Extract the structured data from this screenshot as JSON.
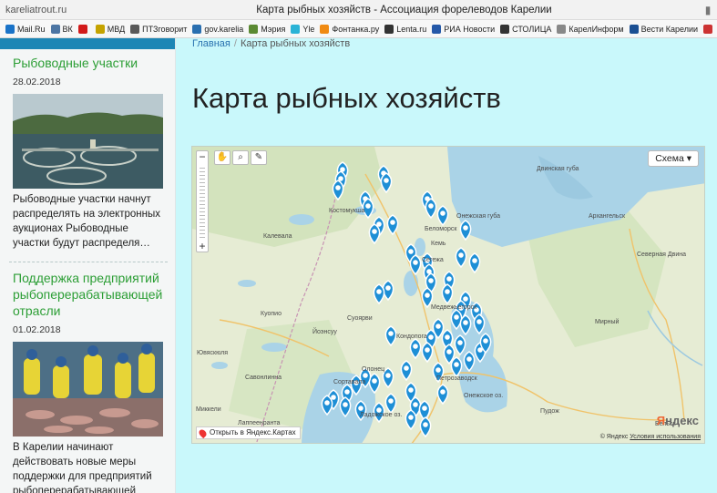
{
  "window": {
    "host": "kareliatrout.ru",
    "title": "Карта рыбных хозяйств - Ассоциация форелеводов Карелии",
    "bookmark_star": "▮"
  },
  "bookmarks": [
    {
      "label": "Mail.Ru",
      "color": "#1a73c8"
    },
    {
      "label": "ВК",
      "color": "#4c75a3"
    },
    {
      "label": "",
      "color": "#d21a1a"
    },
    {
      "label": "МВД",
      "color": "#c5a300"
    },
    {
      "label": "ПТЗговорит",
      "color": "#5a5a5a"
    },
    {
      "label": "gov.karelia",
      "color": "#2a6fb0"
    },
    {
      "label": "Мэрия",
      "color": "#5b8a33"
    },
    {
      "label": "Yle",
      "color": "#2ab3d6"
    },
    {
      "label": "Фонтанка.ру",
      "color": "#f08a12"
    },
    {
      "label": "Lenta.ru",
      "color": "#333333"
    },
    {
      "label": "РИА Новости",
      "color": "#2458a8"
    },
    {
      "label": "СТОЛИЦА",
      "color": "#333333"
    },
    {
      "label": "КарелИнформ",
      "color": "#888888"
    },
    {
      "label": "Вести Карелии",
      "color": "#1b4f93"
    },
    {
      "label": "",
      "color": "#c33"
    }
  ],
  "sidebar": {
    "news": [
      {
        "title": "Рыбоводные участки",
        "date": "28.02.2018",
        "text": "Рыбоводные участки начнут распределять на электронных аукционах Рыбоводные участки будут распределя…"
      },
      {
        "title": "Поддержка предприятий рыбоперерабатывающей отрасли",
        "date": "01.02.2018",
        "text": "В Карелии начинают действовать новые меры поддержки для предприятий рыбоперерабатывающей"
      }
    ]
  },
  "main": {
    "breadcrumb": {
      "home": "Главная",
      "separator": "/",
      "current": "Карта рыбных хозяйств"
    },
    "title": "Карта рыбных хозяйств"
  },
  "map": {
    "zoom_in": "−",
    "zoom_out": "+",
    "layers_label": "Схема ▾",
    "open_label": "Открыть в Яндекс.Картах",
    "logo_a": "Я",
    "logo_b": "ндекс",
    "attribution": "© Яндекс",
    "terms": "Условия использования",
    "places": [
      "Костомукша",
      "Сегежа",
      "Кемь",
      "Беломорск",
      "Калевала",
      "Кондопога",
      "Петрозаводск",
      "Медвежьегорск",
      "Пудож",
      "Сортавала",
      "Олонец",
      "Суоярви",
      "Онежская губа",
      "Архангельск",
      "Двинская губа",
      "Онежское оз.",
      "Ладожское оз.",
      "Вельск",
      "Мирный",
      "Северная Двина",
      "Йоэнсуу",
      "Савонлинна",
      "Лаппеенранта",
      "Куопио",
      "Ювяскюля",
      "Миккели"
    ],
    "marker_color": "#1e8fd6"
  }
}
